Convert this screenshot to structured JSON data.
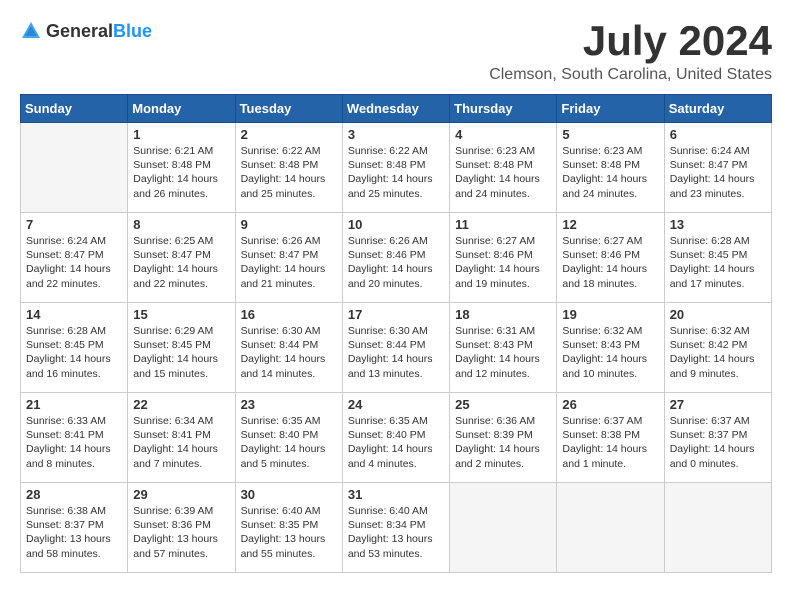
{
  "header": {
    "logo_general": "General",
    "logo_blue": "Blue",
    "month_title": "July 2024",
    "location": "Clemson, South Carolina, United States"
  },
  "calendar": {
    "days_of_week": [
      "Sunday",
      "Monday",
      "Tuesday",
      "Wednesday",
      "Thursday",
      "Friday",
      "Saturday"
    ],
    "weeks": [
      [
        {
          "day": "",
          "content": ""
        },
        {
          "day": "1",
          "content": "Sunrise: 6:21 AM\nSunset: 8:48 PM\nDaylight: 14 hours\nand 26 minutes."
        },
        {
          "day": "2",
          "content": "Sunrise: 6:22 AM\nSunset: 8:48 PM\nDaylight: 14 hours\nand 25 minutes."
        },
        {
          "day": "3",
          "content": "Sunrise: 6:22 AM\nSunset: 8:48 PM\nDaylight: 14 hours\nand 25 minutes."
        },
        {
          "day": "4",
          "content": "Sunrise: 6:23 AM\nSunset: 8:48 PM\nDaylight: 14 hours\nand 24 minutes."
        },
        {
          "day": "5",
          "content": "Sunrise: 6:23 AM\nSunset: 8:48 PM\nDaylight: 14 hours\nand 24 minutes."
        },
        {
          "day": "6",
          "content": "Sunrise: 6:24 AM\nSunset: 8:47 PM\nDaylight: 14 hours\nand 23 minutes."
        }
      ],
      [
        {
          "day": "7",
          "content": "Sunrise: 6:24 AM\nSunset: 8:47 PM\nDaylight: 14 hours\nand 22 minutes."
        },
        {
          "day": "8",
          "content": "Sunrise: 6:25 AM\nSunset: 8:47 PM\nDaylight: 14 hours\nand 22 minutes."
        },
        {
          "day": "9",
          "content": "Sunrise: 6:26 AM\nSunset: 8:47 PM\nDaylight: 14 hours\nand 21 minutes."
        },
        {
          "day": "10",
          "content": "Sunrise: 6:26 AM\nSunset: 8:46 PM\nDaylight: 14 hours\nand 20 minutes."
        },
        {
          "day": "11",
          "content": "Sunrise: 6:27 AM\nSunset: 8:46 PM\nDaylight: 14 hours\nand 19 minutes."
        },
        {
          "day": "12",
          "content": "Sunrise: 6:27 AM\nSunset: 8:46 PM\nDaylight: 14 hours\nand 18 minutes."
        },
        {
          "day": "13",
          "content": "Sunrise: 6:28 AM\nSunset: 8:45 PM\nDaylight: 14 hours\nand 17 minutes."
        }
      ],
      [
        {
          "day": "14",
          "content": "Sunrise: 6:28 AM\nSunset: 8:45 PM\nDaylight: 14 hours\nand 16 minutes."
        },
        {
          "day": "15",
          "content": "Sunrise: 6:29 AM\nSunset: 8:45 PM\nDaylight: 14 hours\nand 15 minutes."
        },
        {
          "day": "16",
          "content": "Sunrise: 6:30 AM\nSunset: 8:44 PM\nDaylight: 14 hours\nand 14 minutes."
        },
        {
          "day": "17",
          "content": "Sunrise: 6:30 AM\nSunset: 8:44 PM\nDaylight: 14 hours\nand 13 minutes."
        },
        {
          "day": "18",
          "content": "Sunrise: 6:31 AM\nSunset: 8:43 PM\nDaylight: 14 hours\nand 12 minutes."
        },
        {
          "day": "19",
          "content": "Sunrise: 6:32 AM\nSunset: 8:43 PM\nDaylight: 14 hours\nand 10 minutes."
        },
        {
          "day": "20",
          "content": "Sunrise: 6:32 AM\nSunset: 8:42 PM\nDaylight: 14 hours\nand 9 minutes."
        }
      ],
      [
        {
          "day": "21",
          "content": "Sunrise: 6:33 AM\nSunset: 8:41 PM\nDaylight: 14 hours\nand 8 minutes."
        },
        {
          "day": "22",
          "content": "Sunrise: 6:34 AM\nSunset: 8:41 PM\nDaylight: 14 hours\nand 7 minutes."
        },
        {
          "day": "23",
          "content": "Sunrise: 6:35 AM\nSunset: 8:40 PM\nDaylight: 14 hours\nand 5 minutes."
        },
        {
          "day": "24",
          "content": "Sunrise: 6:35 AM\nSunset: 8:40 PM\nDaylight: 14 hours\nand 4 minutes."
        },
        {
          "day": "25",
          "content": "Sunrise: 6:36 AM\nSunset: 8:39 PM\nDaylight: 14 hours\nand 2 minutes."
        },
        {
          "day": "26",
          "content": "Sunrise: 6:37 AM\nSunset: 8:38 PM\nDaylight: 14 hours\nand 1 minute."
        },
        {
          "day": "27",
          "content": "Sunrise: 6:37 AM\nSunset: 8:37 PM\nDaylight: 14 hours\nand 0 minutes."
        }
      ],
      [
        {
          "day": "28",
          "content": "Sunrise: 6:38 AM\nSunset: 8:37 PM\nDaylight: 13 hours\nand 58 minutes."
        },
        {
          "day": "29",
          "content": "Sunrise: 6:39 AM\nSunset: 8:36 PM\nDaylight: 13 hours\nand 57 minutes."
        },
        {
          "day": "30",
          "content": "Sunrise: 6:40 AM\nSunset: 8:35 PM\nDaylight: 13 hours\nand 55 minutes."
        },
        {
          "day": "31",
          "content": "Sunrise: 6:40 AM\nSunset: 8:34 PM\nDaylight: 13 hours\nand 53 minutes."
        },
        {
          "day": "",
          "content": ""
        },
        {
          "day": "",
          "content": ""
        },
        {
          "day": "",
          "content": ""
        }
      ]
    ]
  }
}
